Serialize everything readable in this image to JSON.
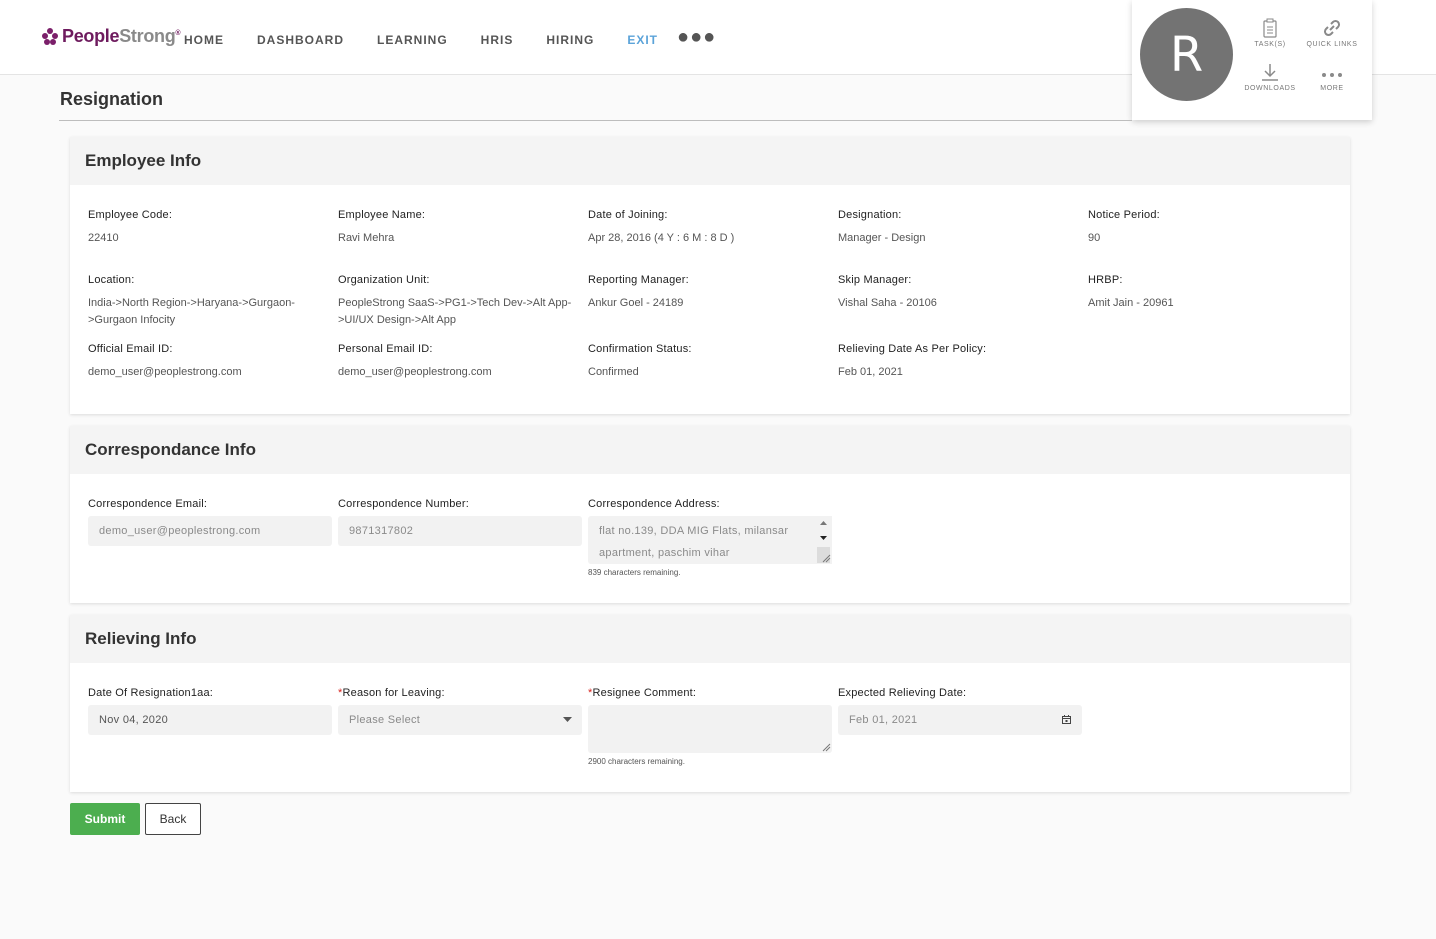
{
  "header": {
    "logo_text_1": "People",
    "logo_text_2": "Strong",
    "logo_reg": "®",
    "nav": [
      "HOME",
      "DASHBOARD",
      "LEARNING",
      "HRIS",
      "HIRING",
      "EXIT"
    ],
    "active_nav": "EXIT",
    "accent_color": "#5ba3d9",
    "brand_color": "#6e1b5e"
  },
  "profile": {
    "initial": "R",
    "tasks_label": "TASK(S)",
    "quick_links_label": "QUICK LINKS",
    "downloads_label": "DOWNLOADS",
    "more_label": "MORE"
  },
  "page": {
    "title": "Resignation"
  },
  "employee_info": {
    "title": "Employee Info",
    "employee_code": {
      "label": "Employee Code:",
      "value": "22410"
    },
    "employee_name": {
      "label": "Employee Name:",
      "value": "Ravi Mehra"
    },
    "date_of_joining": {
      "label": "Date of Joining:",
      "value": "Apr 28, 2016 (4 Y : 6 M : 8 D )"
    },
    "designation": {
      "label": "Designation:",
      "value": "Manager - Design"
    },
    "notice_period": {
      "label": "Notice Period:",
      "value": "90"
    },
    "location": {
      "label": "Location:",
      "value": "India->North Region->Haryana->Gurgaon->Gurgaon Infocity"
    },
    "organization_unit": {
      "label": "Organization Unit:",
      "value": "PeopleStrong SaaS->PG1->Tech Dev->Alt App->UI/UX Design->Alt App"
    },
    "reporting_manager": {
      "label": "Reporting Manager:",
      "value": "Ankur Goel - 24189"
    },
    "skip_manager": {
      "label": "Skip Manager:",
      "value": "Vishal Saha - 20106"
    },
    "hrbp": {
      "label": "HRBP:",
      "value": "Amit Jain - 20961"
    },
    "official_email": {
      "label": "Official Email ID:",
      "value": "demo_user@peoplestrong.com"
    },
    "personal_email": {
      "label": "Personal Email ID:",
      "value": "demo_user@peoplestrong.com"
    },
    "confirmation_status": {
      "label": "Confirmation Status:",
      "value": "Confirmed"
    },
    "relieving_date_policy": {
      "label": "Relieving Date As Per Policy:",
      "value": "Feb 01, 2021"
    }
  },
  "correspondance_info": {
    "title": "Correspondance Info",
    "email": {
      "label": "Correspondence Email:",
      "value": "demo_user@peoplestrong.com"
    },
    "number": {
      "label": "Correspondence Number:",
      "value": "9871317802"
    },
    "address": {
      "label": "Correspondence Address:",
      "line1": "flat no.139, DDA MIG Flats, milansar",
      "line2": "apartment, paschim vihar"
    },
    "address_remaining": "839 characters remaining."
  },
  "relieving_info": {
    "title": "Relieving Info",
    "date_of_resignation": {
      "label": "Date Of Resignation1aa:",
      "value": "Nov 04, 2020"
    },
    "reason": {
      "required_mark": "*",
      "label": "Reason for Leaving:",
      "placeholder": "Please Select"
    },
    "comment": {
      "required_mark": "*",
      "label": "Resignee Comment:",
      "value": ""
    },
    "comment_remaining": "2900 characters remaining.",
    "expected_relieving": {
      "label": "Expected Relieving Date:",
      "value": "Feb 01, 2021"
    }
  },
  "actions": {
    "submit": "Submit",
    "back": "Back",
    "submit_color": "#4cae4f"
  }
}
